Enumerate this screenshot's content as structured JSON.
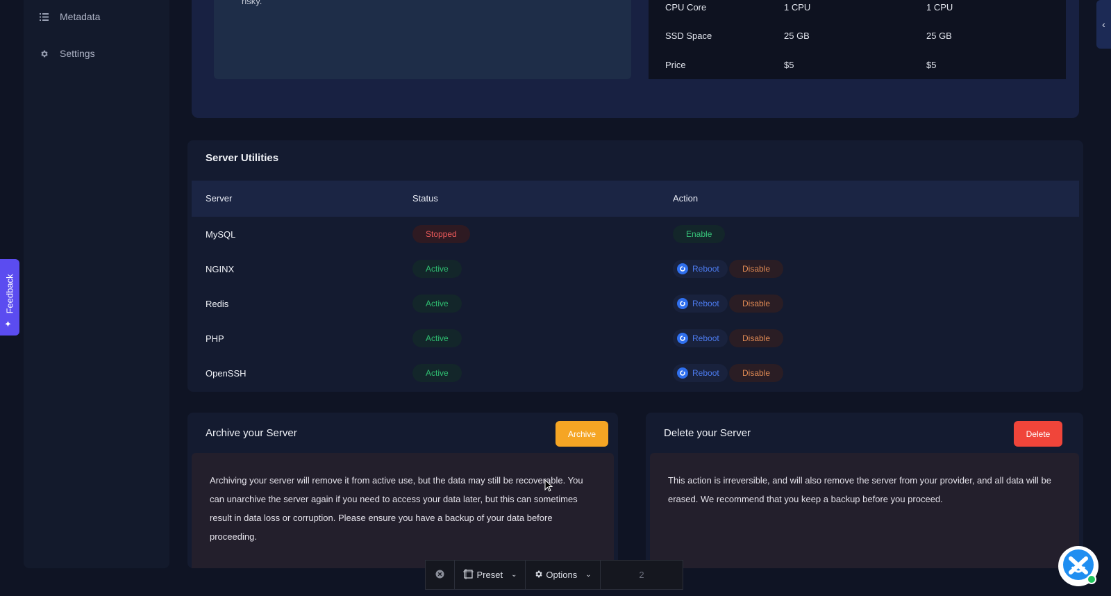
{
  "sidebar": {
    "items": [
      {
        "label": "Metadata",
        "icon": "list-icon"
      },
      {
        "label": "Settings",
        "icon": "gear-icon"
      }
    ]
  },
  "server_overview": {
    "note_text": "risky.",
    "specs": [
      {
        "label": "CPU Core",
        "current": "1 CPU",
        "new": "1 CPU"
      },
      {
        "label": "SSD Space",
        "current": "25 GB",
        "new": "25 GB"
      },
      {
        "label": "Price",
        "current": "$5",
        "new": "$5"
      }
    ]
  },
  "utilities": {
    "title": "Server Utilities",
    "columns": [
      "Server",
      "Status",
      "Action"
    ],
    "rows": [
      {
        "name": "MySQL",
        "status": "Stopped",
        "actions": [
          "Enable"
        ]
      },
      {
        "name": "NGINX",
        "status": "Active",
        "actions": [
          "Reboot",
          "Disable"
        ]
      },
      {
        "name": "Redis",
        "status": "Active",
        "actions": [
          "Reboot",
          "Disable"
        ]
      },
      {
        "name": "PHP",
        "status": "Active",
        "actions": [
          "Reboot",
          "Disable"
        ]
      },
      {
        "name": "OpenSSH",
        "status": "Active",
        "actions": [
          "Reboot",
          "Disable"
        ]
      }
    ]
  },
  "archive": {
    "title": "Archive your Server",
    "button": "Archive",
    "text": "Archiving your server will remove it from active use, but the data may still be recoverable. You can unarchive the server again if you need to access your data later, but this can sometimes result in data loss or corruption. Please ensure you have a backup of your data before proceeding."
  },
  "delete": {
    "title": "Delete your Server",
    "button": "Delete",
    "text": "This action is irreversible, and will also remove the server from your provider, and all data will be erased. We recommend that you keep a backup before you proceed."
  },
  "feedback_tab": {
    "label": "Feedback"
  },
  "toolbar": {
    "preset": "Preset",
    "options": "Options",
    "count": "2"
  },
  "colors": {
    "accent_archive": "#f5a524",
    "accent_delete": "#f0453a",
    "status_active": "#2fbf71",
    "status_stopped": "#ef5b5b",
    "reboot": "#4c7bef",
    "feedback": "#5b4cf0"
  }
}
